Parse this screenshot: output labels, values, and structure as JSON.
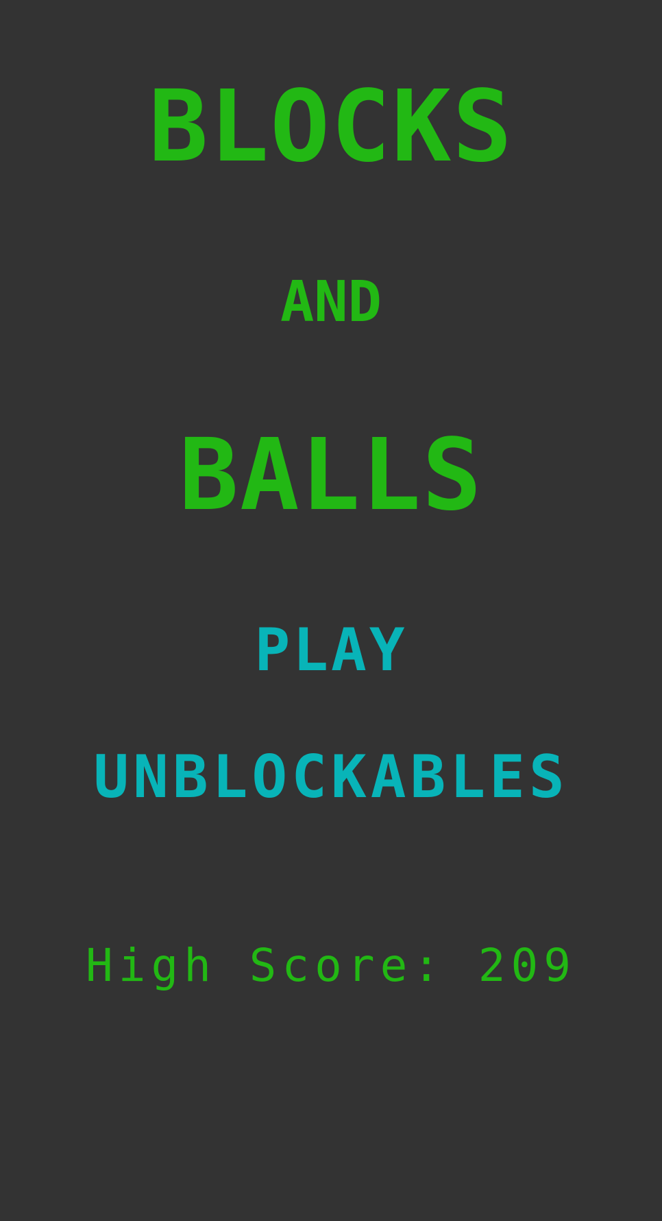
{
  "colors": {
    "background": "#333333",
    "title": "#22b814",
    "menu": "#08b4b8",
    "score": "#22b814"
  },
  "title": {
    "line1": "BLOCKS",
    "line2": "AND",
    "line3": "BALLS"
  },
  "menu": {
    "play_label": "PLAY",
    "unblockables_label": "UNBLOCKABLES"
  },
  "high_score": {
    "text": "High Score: 209"
  }
}
